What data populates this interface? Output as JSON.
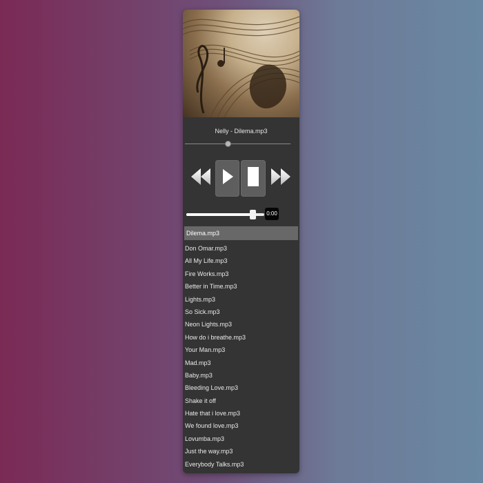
{
  "player": {
    "now_playing": "Nelly - Dilema.mp3",
    "seek_progress": 0.4,
    "volume_level": 0.85,
    "time_display": "0:00",
    "controls": {
      "rewind_icon": "rewind-icon",
      "play_icon": "play-icon",
      "stop_icon": "stop-icon",
      "forward_icon": "fast-forward-icon"
    }
  },
  "playlist": {
    "active_track": "Dilema.mp3",
    "tracks": [
      "Don Omar.mp3",
      "All My Life.mp3",
      "Fire Works.mp3",
      "Better in Time.mp3",
      "Lights.mp3",
      "So Sick.mp3",
      "Neon Lights.mp3",
      "How do i breathe.mp3",
      "Your Man.mp3",
      "Mad.mp3",
      "Baby.mp3",
      "Bleeding Love.mp3",
      "Shake it off",
      "Hate that i love.mp3",
      "We found love.mp3",
      "Lovumba.mp3",
      "Just the way.mp3",
      "Everybody Talks.mp3"
    ]
  },
  "colors": {
    "panel": "#343434",
    "active_row": "#686868",
    "button_bg": "#5e5e5e"
  }
}
